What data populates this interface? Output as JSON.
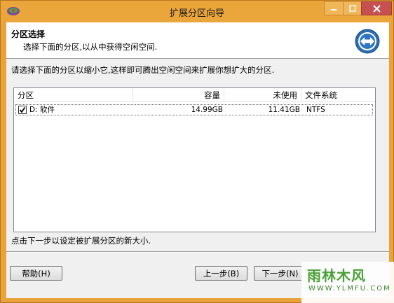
{
  "window": {
    "title": "扩展分区向导",
    "frame_color": "#eaa53b",
    "close_color": "#c75050"
  },
  "header": {
    "title": "分区选择",
    "subtitle": "选择下面的分区,以从中获得空闲空间."
  },
  "intro": "请选择下面的分区以缩小它,这样即可腾出空闲空间来扩展你想扩大的分区.",
  "table": {
    "columns": [
      "分区",
      "容量",
      "未使用",
      "文件系统"
    ],
    "rows": [
      {
        "checked": true,
        "name": "D: 软件",
        "capacity": "14.99GB",
        "unused": "11.41GB",
        "filesystem": "NTFS"
      }
    ]
  },
  "footnote": "点击下一步以设定被扩展分区的新大小.",
  "buttons": {
    "help": "帮助(H)",
    "back": "上一步(B)",
    "next": "下一步(N)"
  },
  "watermark": {
    "text": "雨林木风",
    "url": "WWW.YLMFU.COM"
  },
  "icons": {
    "app": "partition-tool-icon",
    "header": "resize-arrows-icon",
    "minimize": "minimize-icon",
    "maximize": "maximize-icon",
    "close": "close-icon"
  }
}
